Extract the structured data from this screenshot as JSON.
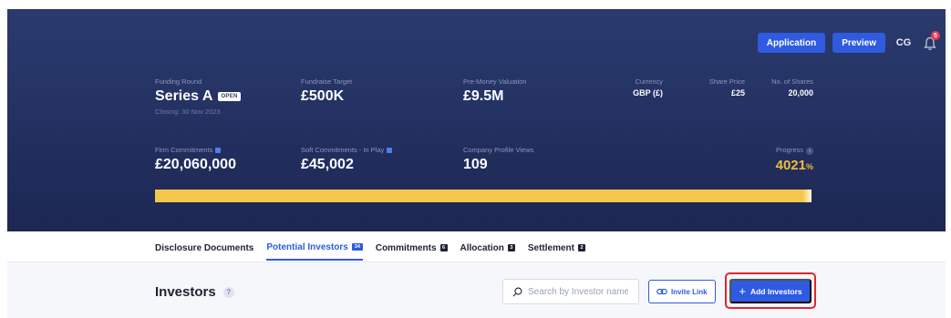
{
  "header": {
    "application_label": "Application",
    "preview_label": "Preview",
    "avatar_initials": "CG",
    "notification_count": "5"
  },
  "stats": {
    "funding_round": {
      "label": "Funding Round",
      "value": "Series A",
      "badge": "OPEN",
      "sub": "Closing: 30 Nov 2023"
    },
    "fundraise_target": {
      "label": "Fundraise Target",
      "value": "£500K"
    },
    "pre_money": {
      "label": "Pre-Money Valuation",
      "value": "£9.5M"
    },
    "currency": {
      "label": "Currency",
      "value": "GBP (£)"
    },
    "share_price": {
      "label": "Share Price",
      "value": "£25"
    },
    "num_shares": {
      "label": "No. of Shares",
      "value": "20,000"
    },
    "firm_commitments": {
      "label": "Firm Commitments",
      "value": "£20,060,000"
    },
    "soft_commitments": {
      "label": "Soft Commitments - In Play",
      "value": "£45,002"
    },
    "profile_views": {
      "label": "Company Profile Views",
      "value": "109"
    },
    "progress": {
      "label": "Progress",
      "value": "4021",
      "unit": "%",
      "fill_fraction": 1.0
    }
  },
  "tabs": [
    {
      "label": "Disclosure Documents",
      "count": "",
      "active": false
    },
    {
      "label": "Potential Investors",
      "count": "34",
      "active": true
    },
    {
      "label": "Commitments",
      "count": "6",
      "active": false
    },
    {
      "label": "Allocation",
      "count": "3",
      "active": false
    },
    {
      "label": "Settlement",
      "count": "2",
      "active": false
    }
  ],
  "investors": {
    "title": "Investors",
    "help": "?",
    "search_placeholder": "Search by Investor name",
    "invite_link_label": "Invite Link",
    "add_investors_label": "Add Investors"
  },
  "colors": {
    "hero_top": "#2b3a6e",
    "hero_bottom": "#1c2752",
    "accent": "#2f5be0",
    "progress": "#f4c64c",
    "highlight": "#e0262f"
  }
}
